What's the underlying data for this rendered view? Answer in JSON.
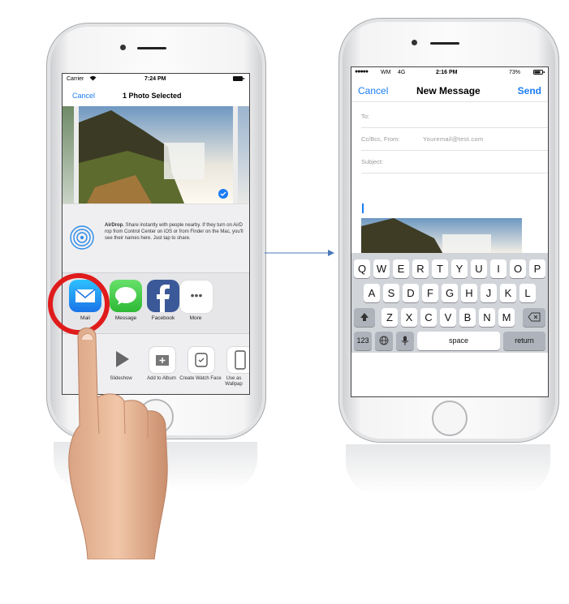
{
  "share_sheet": {
    "status": {
      "carrier": "Carrier",
      "time": "7:24 PM"
    },
    "nav": {
      "cancel": "Cancel",
      "title": "1 Photo Selected"
    },
    "airdrop": {
      "title": "AirDrop.",
      "text": "Share instantly with people nearby. If they turn on AirD rop from Control Center on iOS or from Finder on the Mac, you'll see their names here. Just tap to share."
    },
    "apps": [
      {
        "label": "Mail",
        "icon": "mail-icon"
      },
      {
        "label": "Message",
        "icon": "message-icon"
      },
      {
        "label": "Facebook",
        "icon": "facebook-icon"
      },
      {
        "label": "More",
        "icon": "more-icon"
      }
    ],
    "actions": [
      {
        "label": "Slideshow",
        "icon": "play-icon"
      },
      {
        "label": "Add to Album",
        "icon": "add-album-icon"
      },
      {
        "label": "Create Watch Face",
        "icon": "watch-icon"
      },
      {
        "label": "Use as Wallpap",
        "icon": "phone-icon"
      }
    ]
  },
  "mail": {
    "status": {
      "carrier": "WM",
      "network": "4G",
      "time": "2:16 PM",
      "battery": "73%"
    },
    "nav": {
      "cancel": "Cancel",
      "title": "New Message",
      "send": "Send"
    },
    "fields": {
      "to": "To:",
      "ccbcc_label": "Cc/Bcc, From:",
      "from_value": "Youremail@test.com",
      "subject": "Subject:"
    },
    "keyboard": {
      "row1": [
        "Q",
        "W",
        "E",
        "R",
        "T",
        "Y",
        "U",
        "I",
        "O",
        "P"
      ],
      "row2": [
        "A",
        "S",
        "D",
        "F",
        "G",
        "H",
        "J",
        "K",
        "L"
      ],
      "row3": [
        "Z",
        "X",
        "C",
        "V",
        "B",
        "N",
        "M"
      ],
      "numbers_key": "123",
      "space_key": "space",
      "return_key": "return"
    }
  },
  "colors": {
    "ios_blue": "#1b7cf5",
    "highlight_ring": "#e01b1b",
    "arrow": "#4a78b8"
  }
}
